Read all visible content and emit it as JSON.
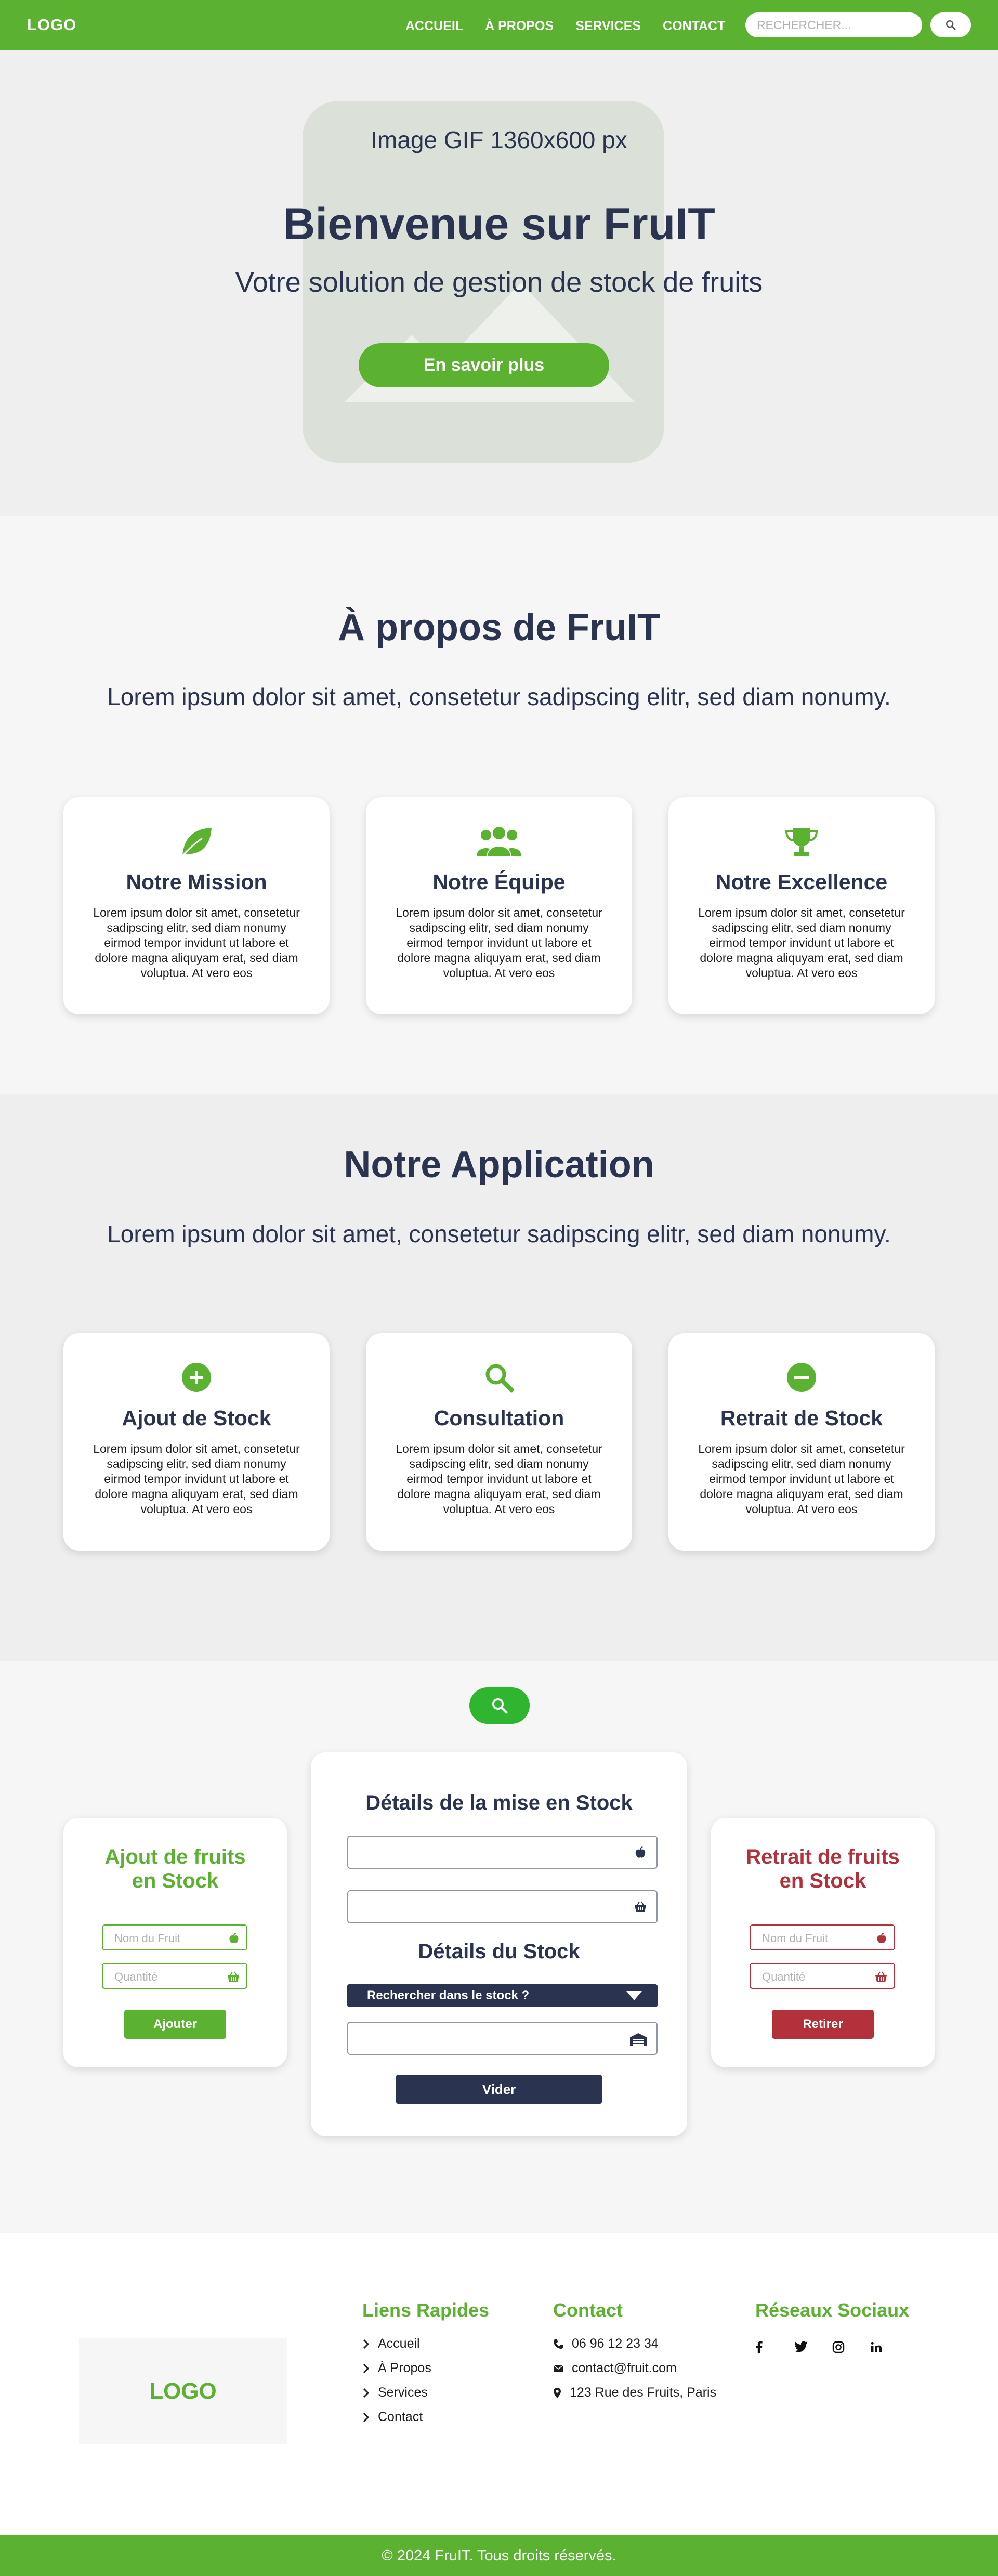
{
  "nav": {
    "logo": "LOGO",
    "links": [
      "ACCUEIL",
      "À PROPOS",
      "SERVICES",
      "CONTACT"
    ],
    "search_placeholder": "RECHERCHER..."
  },
  "hero": {
    "image_caption": "Image GIF 1360x600 px",
    "title": "Bienvenue sur FruIT",
    "subtitle": "Votre solution de gestion de stock de fruits",
    "cta": "En savoir plus"
  },
  "about": {
    "title": "À propos de FruIT",
    "subtitle": "Lorem ipsum dolor sit amet, consetetur sadipscing elitr, sed diam nonumy.",
    "cards": [
      {
        "title": "Notre Mission",
        "icon": "leaf-icon",
        "text": "Lorem ipsum dolor sit amet, consetetur sadipscing elitr, sed diam nonumy eirmod tempor invidunt ut labore et dolore magna aliquyam erat, sed diam voluptua. At vero eos"
      },
      {
        "title": "Notre Équipe",
        "icon": "team-icon",
        "text": "Lorem ipsum dolor sit amet, consetetur sadipscing elitr, sed diam nonumy eirmod tempor invidunt ut labore et dolore magna aliquyam erat, sed diam voluptua. At vero eos"
      },
      {
        "title": "Notre Excellence",
        "icon": "trophy-icon",
        "text": "Lorem ipsum dolor sit amet, consetetur sadipscing elitr, sed diam nonumy eirmod tempor invidunt ut labore et dolore magna aliquyam erat, sed diam voluptua. At vero eos"
      }
    ]
  },
  "application": {
    "title": "Notre Application",
    "subtitle": "Lorem ipsum dolor sit amet, consetetur sadipscing elitr, sed diam nonumy.",
    "cards": [
      {
        "title": "Ajout de Stock",
        "icon": "plus-circle-icon",
        "text": "Lorem ipsum dolor sit amet, consetetur sadipscing elitr, sed diam nonumy eirmod tempor invidunt ut labore et dolore magna aliquyam erat, sed diam voluptua. At vero eos"
      },
      {
        "title": "Consultation",
        "icon": "search-icon",
        "text": "Lorem ipsum dolor sit amet, consetetur sadipscing elitr, sed diam nonumy eirmod tempor invidunt ut labore et dolore magna aliquyam erat, sed diam voluptua. At vero eos"
      },
      {
        "title": "Retrait de Stock",
        "icon": "minus-circle-icon",
        "text": "Lorem ipsum dolor sit amet, consetetur sadipscing elitr, sed diam nonumy eirmod tempor invidunt ut labore et dolore magna aliquyam erat, sed diam voluptua. At vero eos"
      }
    ]
  },
  "stock": {
    "add": {
      "title": "Ajout de fruits en Stock",
      "fruit_placeholder": "Nom du Fruit",
      "qty_placeholder": "Quantité",
      "button": "Ajouter"
    },
    "center": {
      "title": "Détails de la mise en Stock",
      "stock_title": "Détails du Stock",
      "select_label": "Rechercher dans le stock ?",
      "button": "Vider"
    },
    "remove": {
      "title": "Retrait de fruits en Stock",
      "fruit_placeholder": "Nom du Fruit",
      "qty_placeholder": "Quantité",
      "button": "Retirer"
    }
  },
  "footer": {
    "logo": "LOGO",
    "quick_links_title": "Liens Rapides",
    "quick_links": [
      "Accueil",
      "À Propos",
      "Services",
      "Contact"
    ],
    "contact_title": "Contact",
    "phone": "06 96 12 23 34",
    "email": "contact@fruit.com",
    "address": "123 Rue des Fruits, Paris",
    "social_title": "Réseaux Sociaux",
    "copyright": "© 2024 FruIT. Tous droits réservés."
  },
  "colors": {
    "green": "#5bb130",
    "navy": "#2a3450",
    "red": "#b4303a"
  }
}
